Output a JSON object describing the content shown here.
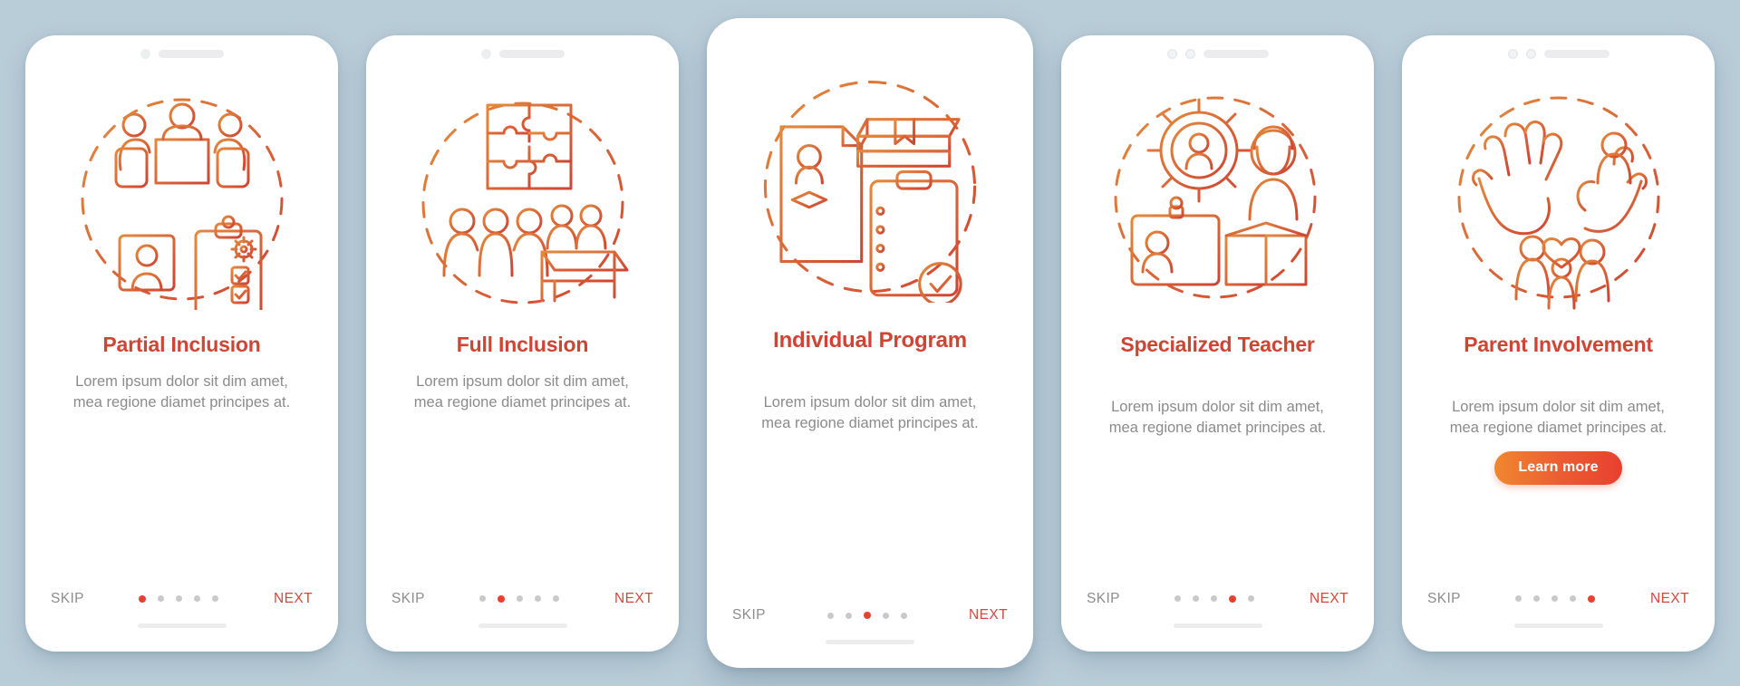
{
  "background_color": "#b9cdd8",
  "theme": {
    "title_color": "#cf4433",
    "body_color": "#8b8b8b",
    "accent_color": "#e8402f",
    "next_color": "#d4483a",
    "skip_color": "#8d8d8d",
    "icon_stroke_start": "#e07b33",
    "icon_stroke_end": "#cf4433",
    "cta_gradient_from": "#f0872f",
    "cta_gradient_to": "#e8402f"
  },
  "common": {
    "skip_label": "SKIP",
    "next_label": "NEXT",
    "body_text": "Lorem ipsum dolor sit dim amet, mea regione diamet principes at.",
    "total_steps": 5
  },
  "screens": [
    {
      "id": "partial-inclusion",
      "title": "Partial Inclusion",
      "body": "Lorem ipsum dolor sit dim amet, mea regione diamet principes at.",
      "skip_label": "SKIP",
      "next_label": "NEXT",
      "active_step": 1,
      "illustration": "meeting-table-org-chart-checklist-icon",
      "notch": "single-camera",
      "cta": null,
      "featured": false
    },
    {
      "id": "full-inclusion",
      "title": "Full Inclusion",
      "body": "Lorem ipsum dolor sit dim amet, mea regione diamet principes at.",
      "skip_label": "SKIP",
      "next_label": "NEXT",
      "active_step": 2,
      "illustration": "puzzle-people-classroom-icon",
      "notch": "single-camera",
      "cta": null,
      "featured": false
    },
    {
      "id": "individual-program",
      "title": "Individual Program",
      "body": "Lorem ipsum dolor sit dim amet, mea regione diamet principes at.",
      "skip_label": "SKIP",
      "next_label": "NEXT",
      "active_step": 3,
      "illustration": "resume-books-checklist-icon",
      "notch": "none",
      "cta": null,
      "featured": true
    },
    {
      "id": "specialized-teacher",
      "title": "Specialized Teacher",
      "body": "Lorem ipsum dolor sit dim amet, mea regione diamet principes at.",
      "skip_label": "SKIP",
      "next_label": "NEXT",
      "active_step": 4,
      "illustration": "gear-person-badge-teacher-icon",
      "notch": "dual-camera",
      "cta": null,
      "featured": false
    },
    {
      "id": "parent-involvement",
      "title": "Parent Involvement",
      "body": "Lorem ipsum dolor sit dim amet, mea regione diamet principes at.",
      "skip_label": "SKIP",
      "next_label": "NEXT",
      "active_step": 5,
      "illustration": "hands-family-heart-icon",
      "notch": "dual-camera",
      "cta": "Learn more",
      "featured": false
    }
  ]
}
